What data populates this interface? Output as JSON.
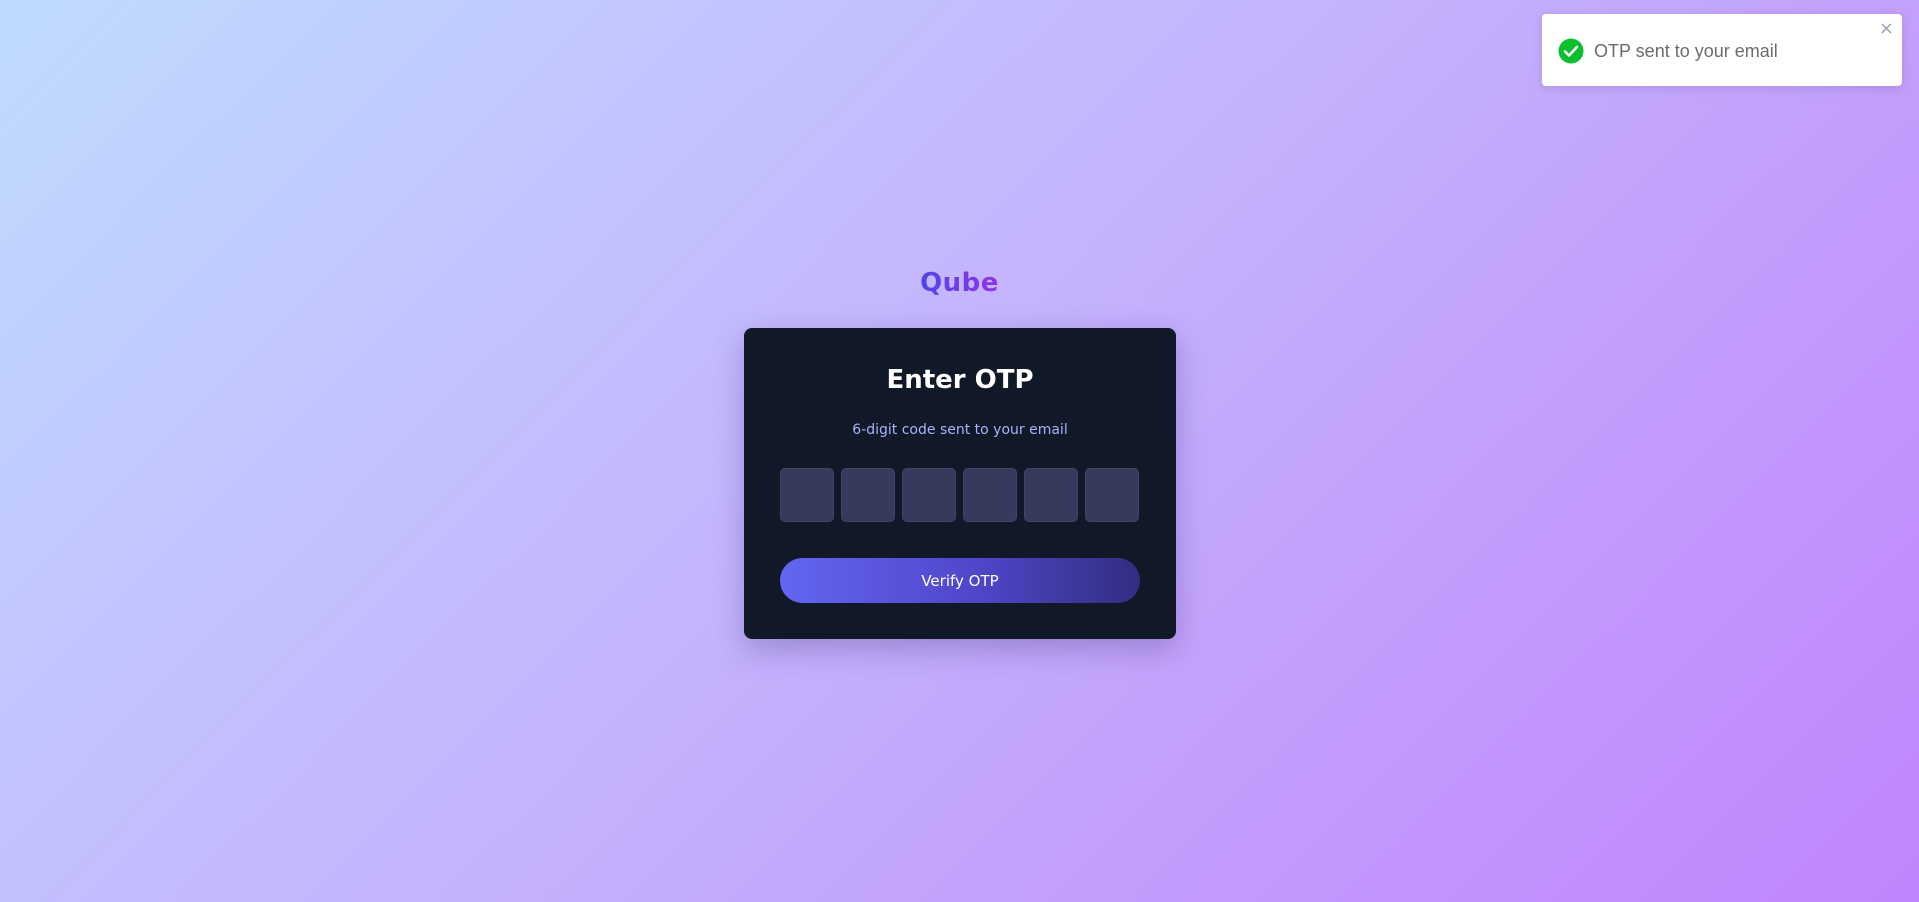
{
  "brand": {
    "name": "Qube"
  },
  "card": {
    "title": "Enter OTP",
    "subtitle": "6-digit code sent to your email",
    "otp_digits": [
      "",
      "",
      "",
      "",
      "",
      ""
    ],
    "verify_label": "Verify OTP"
  },
  "toast": {
    "message": "OTP sent to your email",
    "icon": "check-circle-icon",
    "close_label": "×",
    "status_color": "#0bbf2f"
  },
  "colors": {
    "card_background": "#111827",
    "subtitle": "#a5b4fc",
    "otp_box": "#363a5c",
    "button_start": "#6366f1",
    "button_end": "#312e81"
  }
}
